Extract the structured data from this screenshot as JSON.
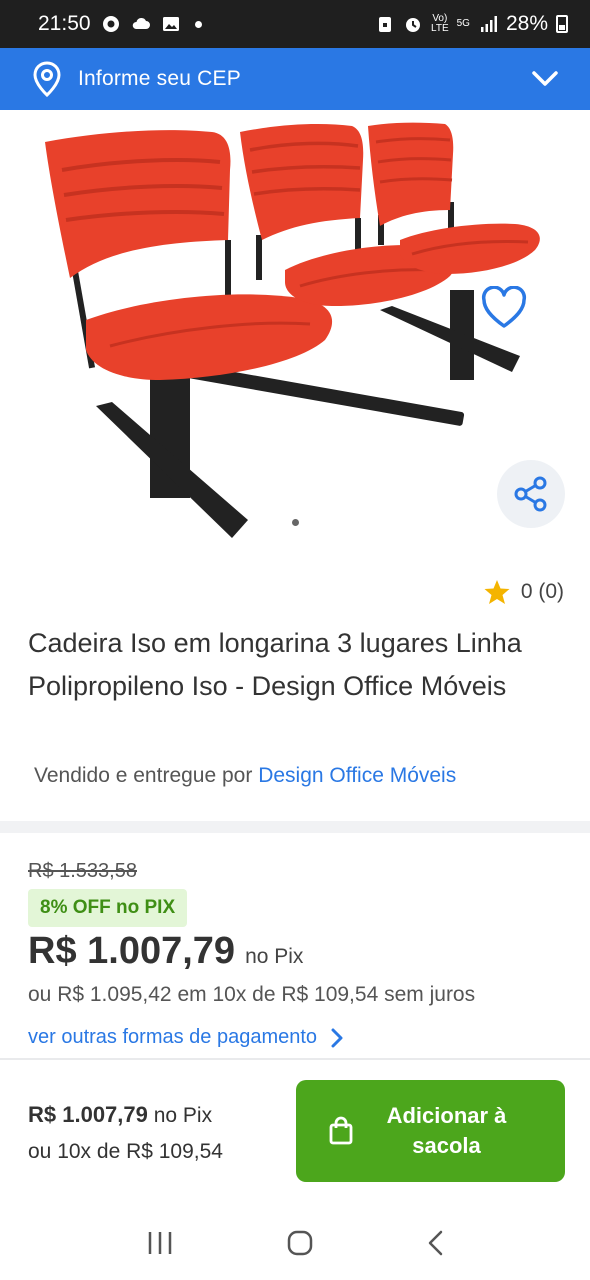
{
  "status_bar": {
    "time": "21:50",
    "net_top": "Vo)",
    "net_bottom": "LTE",
    "gen": "5G",
    "battery": "28%"
  },
  "cep_bar": {
    "label": "Informe seu CEP"
  },
  "product": {
    "rating": "0 (0)",
    "title": "Cadeira Iso em longarina 3 lugares Linha Polipropileno Iso - Design Office Móveis",
    "seller_prefix": "Vendido e entregue por",
    "seller_name": "Design Office Móveis"
  },
  "pricing": {
    "old_price": "R$ 1.533,58",
    "discount_badge": "8% OFF no PIX",
    "price": "R$ 1.007,79",
    "price_suffix": "no Pix",
    "installments": "ou R$ 1.095,42 em 10x de R$ 109,54 sem juros",
    "other_payments": "ver outras formas de pagamento"
  },
  "footer": {
    "price": "R$ 1.007,79",
    "price_suffix": "no Pix",
    "installments": "ou 10x de R$ 109,54",
    "add_button": "Adicionar à sacola"
  },
  "colors": {
    "brand_blue": "#2a78e4",
    "add_green": "#4ca61c",
    "badge_bg": "#e3f6d7",
    "badge_text": "#3f8f15",
    "chair_red": "#e8412b"
  },
  "icons": [
    "location-pin-icon",
    "chevron-down-icon",
    "heart-icon",
    "share-icon",
    "star-icon",
    "chevron-right-icon",
    "shopping-bag-icon",
    "recents-icon",
    "home-icon",
    "back-icon"
  ]
}
